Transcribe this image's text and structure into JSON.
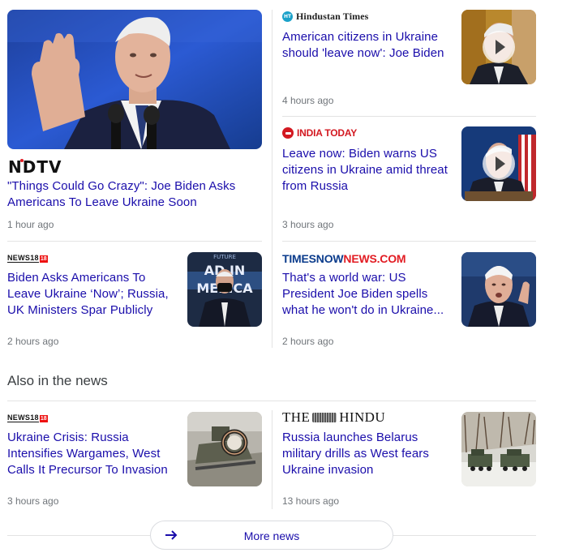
{
  "top_stories": [
    {
      "source": "NDTV",
      "headline": "\"Things Could Go Crazy\": Joe Biden Asks Americans To Leave Ukraine Soon",
      "time": "1 hour ago"
    },
    {
      "source": "Hindustan Times",
      "headline": "American citizens in Ukraine should 'leave now': Joe Biden",
      "time": "4 hours ago"
    },
    {
      "source": "INDIA TODAY",
      "headline": "Leave now: Biden warns US citizens in Ukraine amid threat from Russia",
      "time": "3 hours ago"
    },
    {
      "source": "NEWS18",
      "headline": "Biden Asks Americans To Leave Ukraine ‘Now’; Russia, UK Ministers Spar Publicly",
      "time": "2 hours ago"
    },
    {
      "source_part1": "TIMESNOW",
      "source_part2": "NEWS.COM",
      "headline": "That's a world war: US President Joe Biden spells what he won't do in Ukraine...",
      "time": "2 hours ago"
    }
  ],
  "also_in_news": {
    "title": "Also in the news",
    "stories": [
      {
        "source": "NEWS18",
        "headline": "Ukraine Crisis: Russia Intensifies Wargames, West Calls It Precursor To Invasion",
        "time": "3 hours ago"
      },
      {
        "source_part1": "THE",
        "source_part2": "HINDU",
        "headline": "Russia launches Belarus military drills as West fears Ukraine invasion",
        "time": "13 hours ago"
      }
    ]
  },
  "thumb_texts": {
    "america_banner_line1": "FUTURE",
    "america_banner_line2": "AD IN",
    "america_banner_line3": "MERICA"
  },
  "more_news": {
    "label": "More news"
  },
  "colors": {
    "link": "#1a0dab",
    "meta": "#70757a",
    "divider": "#e3e3e3"
  }
}
